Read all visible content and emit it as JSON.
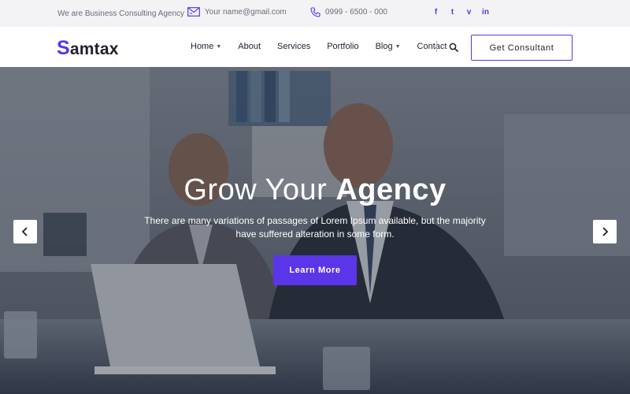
{
  "topbar": {
    "tagline": "We are Business Consulting Agency",
    "email": "Your name@gmail.com",
    "phone": "0999 - 6500 - 000",
    "social": [
      "f",
      "t",
      "v",
      "in"
    ]
  },
  "header": {
    "logo_first": "S",
    "logo_rest": "amtax",
    "nav": {
      "home": "Home",
      "about": "About",
      "services": "Services",
      "portfolio": "Portfolio",
      "blog": "Blog",
      "contact": "Contact"
    },
    "cta_label": "Get Consultant"
  },
  "hero": {
    "title_light": "Grow Your ",
    "title_bold": "Agency",
    "subtitle": "There are many variations of passages of Lorem Ipsum available, but the majority have suffered alteration in some form.",
    "button_label": "Learn More"
  },
  "colors": {
    "accent": "#5b35e8",
    "topbar_bg": "#f3f3f6",
    "text_dark": "#1f1f2e"
  },
  "icons": {
    "email": "envelope-icon",
    "phone": "phone-icon",
    "search": "search-icon",
    "prev": "chevron-left-icon",
    "next": "chevron-right-icon"
  }
}
